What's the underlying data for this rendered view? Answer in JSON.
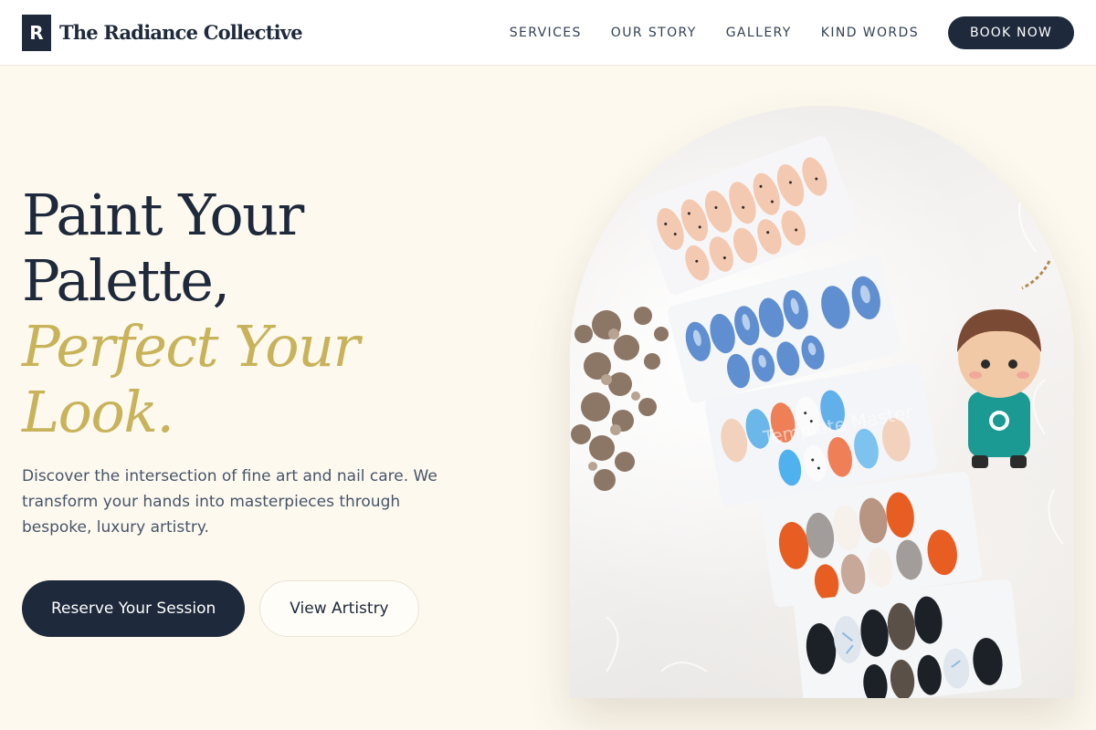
{
  "brand": {
    "logo_letter": "R",
    "name": "The Radiance Collective"
  },
  "nav": {
    "links": [
      "SERVICES",
      "OUR STORY",
      "GALLERY",
      "KIND WORDS"
    ],
    "cta": "BOOK NOW"
  },
  "hero": {
    "headline_lines": [
      "Paint Your",
      "Palette,"
    ],
    "accent_lines": [
      "Perfect Your",
      "Look."
    ],
    "description": "Discover the intersection of fine art and nail care. We transform your hands into masterpieces through bespoke, luxury artistry.",
    "primary_button": "Reserve Your Session",
    "secondary_button": "View Artistry"
  },
  "image": {
    "watermark": "Template Master"
  },
  "colors": {
    "navy": "#1e293b",
    "gold_accent": "#c8b35a",
    "cream_background": "#fdf9ef",
    "body_text": "#475569"
  }
}
